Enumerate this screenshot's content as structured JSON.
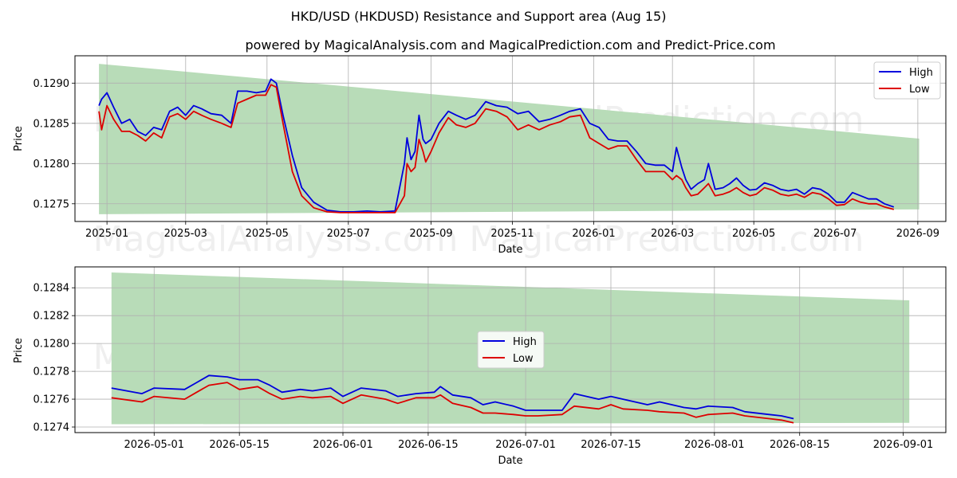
{
  "title": "HKD/USD (HKDUSD) Resistance and Support area (Aug 15)",
  "subtitle": "powered by MagicalAnalysis.com and MagicalPrediction.com and Predict-Price.com",
  "watermark": "MagicalAnalysis.com    MagicalPrediction.com",
  "colors": {
    "high": "#0000dd",
    "low": "#dd0000",
    "band": "#b8dcb8",
    "grid": "#b0b0b0"
  },
  "chart_data": [
    {
      "type": "line",
      "xlabel": "Date",
      "ylabel": "Price",
      "grid": true,
      "legend": "top-right",
      "xlim": [
        "2024-12-08",
        "2026-09-22"
      ],
      "ylim": [
        0.12728,
        0.12934
      ],
      "xticks": [
        {
          "date": "2025-01-01",
          "label": "2025-01"
        },
        {
          "date": "2025-03-01",
          "label": "2025-03"
        },
        {
          "date": "2025-05-01",
          "label": "2025-05"
        },
        {
          "date": "2025-07-01",
          "label": "2025-07"
        },
        {
          "date": "2025-09-01",
          "label": "2025-09"
        },
        {
          "date": "2025-11-01",
          "label": "2025-11"
        },
        {
          "date": "2026-01-01",
          "label": "2026-01"
        },
        {
          "date": "2026-03-01",
          "label": "2026-03"
        },
        {
          "date": "2026-05-01",
          "label": "2026-05"
        },
        {
          "date": "2026-07-01",
          "label": "2026-07"
        },
        {
          "date": "2026-09-01",
          "label": "2026-09"
        }
      ],
      "yticks": [
        0.1275,
        0.128,
        0.1285,
        0.129
      ],
      "ytick_labels": [
        "0.1275",
        "0.1280",
        "0.1285",
        "0.1290"
      ],
      "band": {
        "x": [
          "2024-12-26",
          "2026-09-02"
        ],
        "upper": [
          0.12924,
          0.12831
        ],
        "lower": [
          0.12737,
          0.12743
        ]
      },
      "series": [
        {
          "name": "High",
          "x": [
            "2024-12-26",
            "2024-12-28",
            "2025-01-01",
            "2025-01-06",
            "2025-01-12",
            "2025-01-18",
            "2025-01-24",
            "2025-01-30",
            "2025-02-05",
            "2025-02-11",
            "2025-02-17",
            "2025-02-23",
            "2025-03-01",
            "2025-03-07",
            "2025-03-13",
            "2025-03-20",
            "2025-03-28",
            "2025-04-04",
            "2025-04-09",
            "2025-04-16",
            "2025-04-23",
            "2025-04-30",
            "2025-05-04",
            "2025-05-08",
            "2025-05-13",
            "2025-05-20",
            "2025-05-27",
            "2025-06-05",
            "2025-06-15",
            "2025-06-25",
            "2025-07-05",
            "2025-07-15",
            "2025-07-25",
            "2025-08-05",
            "2025-08-12",
            "2025-08-14",
            "2025-08-17",
            "2025-08-20",
            "2025-08-23",
            "2025-08-26",
            "2025-08-28",
            "2025-09-01",
            "2025-09-07",
            "2025-09-14",
            "2025-09-20",
            "2025-09-27",
            "2025-10-04",
            "2025-10-12",
            "2025-10-20",
            "2025-10-28",
            "2025-11-05",
            "2025-11-13",
            "2025-11-21",
            "2025-11-29",
            "2025-12-07",
            "2025-12-14",
            "2025-12-22",
            "2025-12-29",
            "2026-01-05",
            "2026-01-12",
            "2026-01-19",
            "2026-01-26",
            "2026-02-02",
            "2026-02-09",
            "2026-02-16",
            "2026-02-23",
            "2026-03-01",
            "2026-03-04",
            "2026-03-08",
            "2026-03-11",
            "2026-03-15",
            "2026-03-20",
            "2026-03-25",
            "2026-03-28",
            "2026-04-02",
            "2026-04-08",
            "2026-04-13",
            "2026-04-18",
            "2026-04-23",
            "2026-04-28",
            "2026-05-03",
            "2026-05-09",
            "2026-05-15",
            "2026-05-21",
            "2026-05-27",
            "2026-06-02",
            "2026-06-08",
            "2026-06-14",
            "2026-06-20",
            "2026-06-26",
            "2026-07-02",
            "2026-07-08",
            "2026-07-14",
            "2026-07-20",
            "2026-07-26",
            "2026-08-01",
            "2026-08-07",
            "2026-08-14"
          ],
          "values": [
            0.12872,
            0.1288,
            0.12888,
            0.1287,
            0.1285,
            0.12855,
            0.1284,
            0.12835,
            0.12845,
            0.12842,
            0.12865,
            0.1287,
            0.1286,
            0.12872,
            0.12868,
            0.12862,
            0.1286,
            0.1285,
            0.1289,
            0.1289,
            0.12888,
            0.1289,
            0.12905,
            0.129,
            0.1286,
            0.1281,
            0.1277,
            0.12752,
            0.12742,
            0.1274,
            0.1274,
            0.12741,
            0.1274,
            0.12741,
            0.128,
            0.12832,
            0.12805,
            0.12815,
            0.1286,
            0.1283,
            0.12825,
            0.1283,
            0.1285,
            0.12865,
            0.1286,
            0.12855,
            0.1286,
            0.12877,
            0.12872,
            0.1287,
            0.12862,
            0.12865,
            0.12852,
            0.12855,
            0.1286,
            0.12865,
            0.12868,
            0.1285,
            0.12845,
            0.1283,
            0.12828,
            0.12828,
            0.12815,
            0.128,
            0.12798,
            0.12798,
            0.1279,
            0.1282,
            0.12795,
            0.1278,
            0.12768,
            0.12775,
            0.1278,
            0.128,
            0.12768,
            0.1277,
            0.12775,
            0.12782,
            0.12773,
            0.12767,
            0.12768,
            0.12776,
            0.12773,
            0.12768,
            0.12766,
            0.12768,
            0.12762,
            0.1277,
            0.12768,
            0.12762,
            0.12752,
            0.12752,
            0.12764,
            0.1276,
            0.12756,
            0.12756,
            0.1275,
            0.12746
          ]
        },
        {
          "name": "Low",
          "x": [
            "2024-12-26",
            "2024-12-28",
            "2025-01-01",
            "2025-01-06",
            "2025-01-12",
            "2025-01-18",
            "2025-01-24",
            "2025-01-30",
            "2025-02-05",
            "2025-02-11",
            "2025-02-17",
            "2025-02-23",
            "2025-03-01",
            "2025-03-07",
            "2025-03-13",
            "2025-03-20",
            "2025-03-28",
            "2025-04-04",
            "2025-04-09",
            "2025-04-16",
            "2025-04-23",
            "2025-04-30",
            "2025-05-04",
            "2025-05-08",
            "2025-05-13",
            "2025-05-20",
            "2025-05-27",
            "2025-06-05",
            "2025-06-15",
            "2025-06-25",
            "2025-07-05",
            "2025-07-15",
            "2025-07-25",
            "2025-08-05",
            "2025-08-12",
            "2025-08-14",
            "2025-08-17",
            "2025-08-20",
            "2025-08-23",
            "2025-08-26",
            "2025-08-28",
            "2025-09-01",
            "2025-09-07",
            "2025-09-14",
            "2025-09-20",
            "2025-09-27",
            "2025-10-04",
            "2025-10-12",
            "2025-10-20",
            "2025-10-28",
            "2025-11-05",
            "2025-11-13",
            "2025-11-21",
            "2025-11-29",
            "2025-12-07",
            "2025-12-14",
            "2025-12-22",
            "2025-12-29",
            "2026-01-05",
            "2026-01-12",
            "2026-01-19",
            "2026-01-26",
            "2026-02-02",
            "2026-02-09",
            "2026-02-16",
            "2026-02-23",
            "2026-03-01",
            "2026-03-04",
            "2026-03-08",
            "2026-03-11",
            "2026-03-15",
            "2026-03-20",
            "2026-03-25",
            "2026-03-28",
            "2026-04-02",
            "2026-04-08",
            "2026-04-13",
            "2026-04-18",
            "2026-04-23",
            "2026-04-28",
            "2026-05-03",
            "2026-05-09",
            "2026-05-15",
            "2026-05-21",
            "2026-05-27",
            "2026-06-02",
            "2026-06-08",
            "2026-06-14",
            "2026-06-20",
            "2026-06-26",
            "2026-07-02",
            "2026-07-08",
            "2026-07-14",
            "2026-07-20",
            "2026-07-26",
            "2026-08-01",
            "2026-08-07",
            "2026-08-14"
          ],
          "values": [
            0.12865,
            0.12842,
            0.12872,
            0.12855,
            0.1284,
            0.1284,
            0.12835,
            0.12828,
            0.12838,
            0.12832,
            0.12858,
            0.12862,
            0.12855,
            0.12865,
            0.1286,
            0.12855,
            0.1285,
            0.12845,
            0.12875,
            0.1288,
            0.12885,
            0.12885,
            0.12898,
            0.12895,
            0.1285,
            0.1279,
            0.1276,
            0.12745,
            0.1274,
            0.12739,
            0.12739,
            0.12739,
            0.12739,
            0.12739,
            0.1276,
            0.128,
            0.1279,
            0.12795,
            0.1283,
            0.12815,
            0.12802,
            0.12815,
            0.12838,
            0.12857,
            0.12848,
            0.12845,
            0.1285,
            0.12868,
            0.12865,
            0.12858,
            0.12842,
            0.12848,
            0.12842,
            0.12848,
            0.12852,
            0.12858,
            0.1286,
            0.12832,
            0.12825,
            0.12818,
            0.12822,
            0.12822,
            0.12805,
            0.1279,
            0.1279,
            0.1279,
            0.1278,
            0.12785,
            0.1278,
            0.1277,
            0.1276,
            0.12762,
            0.1277,
            0.12775,
            0.1276,
            0.12762,
            0.12765,
            0.1277,
            0.12764,
            0.1276,
            0.12762,
            0.1277,
            0.12767,
            0.12762,
            0.1276,
            0.12762,
            0.12758,
            0.12764,
            0.12762,
            0.12756,
            0.12748,
            0.12749,
            0.12756,
            0.12752,
            0.1275,
            0.1275,
            0.12746,
            0.12743
          ]
        }
      ]
    },
    {
      "type": "line",
      "xlabel": "Date",
      "ylabel": "Price",
      "grid": true,
      "legend": "center",
      "xlim": [
        "2026-04-18",
        "2026-09-08"
      ],
      "ylim": [
        0.12736,
        0.12855
      ],
      "xticks": [
        {
          "date": "2026-05-01",
          "label": "2026-05-01"
        },
        {
          "date": "2026-05-15",
          "label": "2026-05-15"
        },
        {
          "date": "2026-06-01",
          "label": "2026-06-01"
        },
        {
          "date": "2026-06-15",
          "label": "2026-06-15"
        },
        {
          "date": "2026-07-01",
          "label": "2026-07-01"
        },
        {
          "date": "2026-07-15",
          "label": "2026-07-15"
        },
        {
          "date": "2026-08-01",
          "label": "2026-08-01"
        },
        {
          "date": "2026-08-15",
          "label": "2026-08-15"
        },
        {
          "date": "2026-09-01",
          "label": "2026-09-01"
        }
      ],
      "yticks": [
        0.1274,
        0.1276,
        0.1278,
        0.128,
        0.1282,
        0.1284
      ],
      "ytick_labels": [
        "0.1274",
        "0.1276",
        "0.1278",
        "0.1280",
        "0.1282",
        "0.1284"
      ],
      "band": {
        "x": [
          "2026-04-24",
          "2026-09-02"
        ],
        "upper": [
          0.12851,
          0.12831
        ],
        "lower": [
          0.12742,
          0.12743
        ]
      },
      "series": [
        {
          "name": "High",
          "x": [
            "2026-04-24",
            "2026-04-29",
            "2026-05-01",
            "2026-05-06",
            "2026-05-08",
            "2026-05-10",
            "2026-05-13",
            "2026-05-15",
            "2026-05-18",
            "2026-05-20",
            "2026-05-22",
            "2026-05-25",
            "2026-05-27",
            "2026-05-30",
            "2026-06-01",
            "2026-06-04",
            "2026-06-08",
            "2026-06-10",
            "2026-06-13",
            "2026-06-16",
            "2026-06-17",
            "2026-06-19",
            "2026-06-22",
            "2026-06-24",
            "2026-06-26",
            "2026-06-29",
            "2026-07-01",
            "2026-07-03",
            "2026-07-07",
            "2026-07-09",
            "2026-07-13",
            "2026-07-15",
            "2026-07-17",
            "2026-07-21",
            "2026-07-23",
            "2026-07-27",
            "2026-07-29",
            "2026-07-31",
            "2026-08-04",
            "2026-08-06",
            "2026-08-10",
            "2026-08-12",
            "2026-08-14"
          ],
          "values": [
            0.12768,
            0.12764,
            0.12768,
            0.12767,
            0.12772,
            0.12777,
            0.12776,
            0.12774,
            0.12774,
            0.1277,
            0.12765,
            0.12767,
            0.12766,
            0.12768,
            0.12762,
            0.12768,
            0.12766,
            0.12762,
            0.12764,
            0.12765,
            0.12769,
            0.12763,
            0.12761,
            0.12756,
            0.12758,
            0.12755,
            0.12752,
            0.12752,
            0.12752,
            0.12764,
            0.1276,
            0.12762,
            0.1276,
            0.12756,
            0.12758,
            0.12754,
            0.12753,
            0.12755,
            0.12754,
            0.12751,
            0.12749,
            0.12748,
            0.12746
          ]
        },
        {
          "name": "Low",
          "x": [
            "2026-04-24",
            "2026-04-29",
            "2026-05-01",
            "2026-05-06",
            "2026-05-08",
            "2026-05-10",
            "2026-05-13",
            "2026-05-15",
            "2026-05-18",
            "2026-05-20",
            "2026-05-22",
            "2026-05-25",
            "2026-05-27",
            "2026-05-30",
            "2026-06-01",
            "2026-06-04",
            "2026-06-08",
            "2026-06-10",
            "2026-06-13",
            "2026-06-16",
            "2026-06-17",
            "2026-06-19",
            "2026-06-22",
            "2026-06-24",
            "2026-06-26",
            "2026-06-29",
            "2026-07-01",
            "2026-07-03",
            "2026-07-07",
            "2026-07-09",
            "2026-07-13",
            "2026-07-15",
            "2026-07-17",
            "2026-07-21",
            "2026-07-23",
            "2026-07-27",
            "2026-07-29",
            "2026-07-31",
            "2026-08-04",
            "2026-08-06",
            "2026-08-10",
            "2026-08-12",
            "2026-08-14"
          ],
          "values": [
            0.12761,
            0.12758,
            0.12762,
            0.1276,
            0.12765,
            0.1277,
            0.12772,
            0.12767,
            0.12769,
            0.12764,
            0.1276,
            0.12762,
            0.12761,
            0.12762,
            0.12757,
            0.12763,
            0.1276,
            0.12757,
            0.12761,
            0.12761,
            0.12763,
            0.12757,
            0.12754,
            0.1275,
            0.1275,
            0.12749,
            0.12748,
            0.12748,
            0.12749,
            0.12755,
            0.12753,
            0.12756,
            0.12753,
            0.12752,
            0.12751,
            0.1275,
            0.12747,
            0.12749,
            0.1275,
            0.12748,
            0.12746,
            0.12745,
            0.12743
          ]
        }
      ]
    }
  ]
}
